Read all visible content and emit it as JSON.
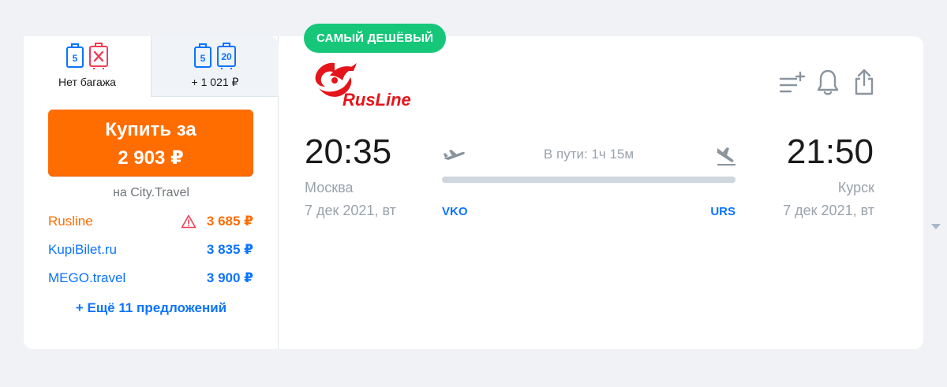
{
  "tabs": [
    {
      "label": "Нет багажа",
      "hand_weight": "5"
    },
    {
      "label": "+ 1 021 ₽",
      "hand_weight": "5",
      "bag_weight": "20"
    }
  ],
  "buy": {
    "line1": "Купить за",
    "line2": "2 903 ₽"
  },
  "via": "на City.Travel",
  "offers": [
    {
      "name": "Rusline",
      "price": "3 685 ₽",
      "color": "#ff6d00",
      "warning": true
    },
    {
      "name": "KupiBilet.ru",
      "price": "3 835 ₽",
      "color": "#0c73fe"
    },
    {
      "name": "MEGO.travel",
      "price": "3 900 ₽",
      "color": "#0c73fe"
    }
  ],
  "more_offers": "+ Ещё 11 предложений",
  "badge": "САМЫЙ ДЕШЁВЫЙ",
  "airline": {
    "name": "RusLine",
    "color": "#e4161b"
  },
  "departure": {
    "time": "20:35",
    "city": "Москва",
    "date": "7 дек 2021, вт",
    "iata": "VKO"
  },
  "arrival": {
    "time": "21:50",
    "city": "Курск",
    "date": "7 дек 2021, вт",
    "iata": "URS"
  },
  "duration": "В пути: 1ч 15м",
  "colors": {
    "accent": "#ff6d00",
    "link": "#0c73fe",
    "badge": "#16c77a",
    "muted": "#9aa2ab"
  },
  "icons": {
    "add_to_list": "list-plus-icon",
    "subscribe": "bell-icon",
    "share": "share-icon"
  }
}
